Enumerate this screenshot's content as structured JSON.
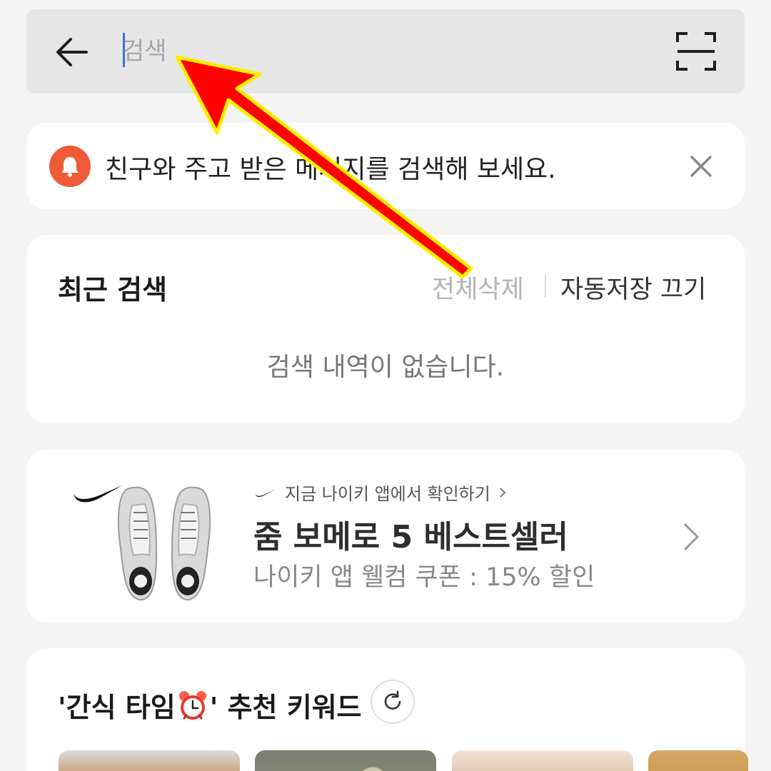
{
  "search": {
    "placeholder": "검색",
    "value": ""
  },
  "notice": {
    "text": "친구와 주고 받은 메시지를 검색해 보세요."
  },
  "recent": {
    "title": "최근 검색",
    "delete_all": "전체삭제",
    "autosave_off": "자동저장 끄기",
    "empty": "검색 내역이 없습니다."
  },
  "ad": {
    "brand_link": "지금 나이키 앱에서 확인하기",
    "title": "줌 보메로 5 베스트셀러",
    "subtitle": "나이키 앱 웰컴 쿠폰 : 15% 할인"
  },
  "keywords": {
    "title_before": "'간식 타임",
    "title_after": "' 추천 키워드"
  },
  "colors": {
    "accent": "#ee5b36",
    "caret": "#3a6fd8",
    "annotation": "#ff0000"
  },
  "icons": [
    "arrow-left-icon",
    "scan-icon",
    "bell-icon",
    "close-icon",
    "nike-swoosh-icon",
    "chevron-right-icon",
    "alarm-clock-icon",
    "refresh-icon"
  ]
}
